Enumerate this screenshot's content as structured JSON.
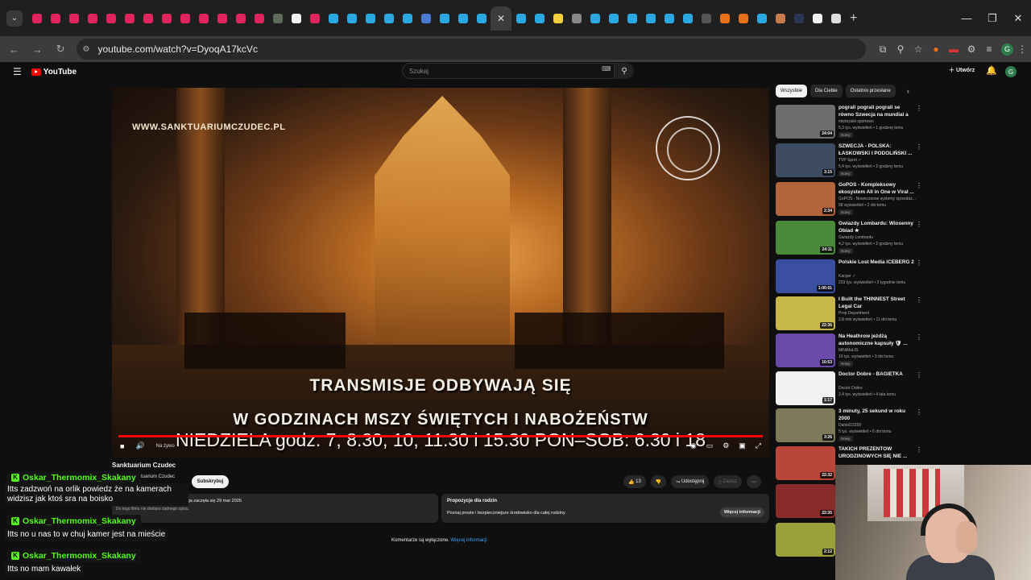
{
  "browser": {
    "url": "youtube.com/watch?v=DyoqA17kcVc",
    "tab_favicons": [
      "#e0245e",
      "#e0245e",
      "#e0245e",
      "#e0245e",
      "#e0245e",
      "#e0245e",
      "#e0245e",
      "#e0245e",
      "#e0245e",
      "#e0245e",
      "#e0245e",
      "#e0245e",
      "#e0245e",
      "#5f6b5a",
      "#f1f1f1",
      "#e0245e",
      "#2aa9e0",
      "#2aa9e0",
      "#2aa9e0",
      "#2aa9e0",
      "#2aa9e0",
      "#4a7bd4",
      "#2aa9e0",
      "#2aa9e0",
      "#2aa9e0"
    ],
    "tab_favicons_after": [
      "#2aa9e0",
      "#2aa9e0",
      "#f4d03f",
      "#888888",
      "#2aa9e0",
      "#2aa9e0",
      "#2aa9e0",
      "#2aa9e0",
      "#2aa9e0",
      "#2aa9e0",
      "#555555",
      "#e8711c",
      "#e8711c",
      "#2aa9e0",
      "#c77b4b",
      "#2a3550",
      "#f1f1f1",
      "#dddddd"
    ],
    "active_tab_close": "✕",
    "new_tab": "+",
    "window_buttons": [
      "—",
      "❐",
      "✕"
    ],
    "ext_icons": [
      "⧉",
      "⚲",
      "☆",
      "●",
      "▬",
      "⚙",
      "≡"
    ],
    "profile_letter": "G"
  },
  "youtube": {
    "logo_text": "YouTube",
    "search_placeholder": "Szukaj",
    "create_label": "Utwórz",
    "notif_count": "9+",
    "avatar_letter": "G"
  },
  "video": {
    "watermark": "WWW.SANKTUARIUMCZUDEC.PL",
    "caption_line1": "TRANSMISJE ODBYWAJĄ SIĘ",
    "caption_line2": "W GODZINACH MSZY ŚWIĘTYCH I NABOŻEŃSTW",
    "caption_line3": "NIEDZIELA godz. 7, 8.30, 10, 11.30 i 15.30   PON–SOB: 6.30 i 18",
    "live_label": "Na żywo",
    "progress": 1.0
  },
  "below": {
    "channel_title": "Sanktuarium Czudec",
    "channel_sub": "tuarium Czudec",
    "subscribe_label": "Subskrybuj",
    "like_count": "13",
    "share_label": "Udostępnij",
    "save_label": "Zapisz",
    "desc_viewers": "W tej chwili ogląda 1 osoba  Transmisja zaczęła się 29 mar 2026",
    "desc_extra": "Do tego filmu nie dodano żadnego opisu.",
    "family_title": "Propozycje dla rodzin",
    "family_text": "Poznaj proste i bezpieczniejsze środowisko dla całej rodziny",
    "family_btn": "Więcej informacji",
    "comments_off": "Komentarze są wyłączone.",
    "comments_link": "Więcej informacji"
  },
  "sidebar": {
    "chips": [
      "Wszystkie",
      "Dla Ciebie",
      "Ostatnio przesłane"
    ],
    "items": [
      {
        "title": "pograli pograli pograli se równo Szwecja na mundial a Polska ...",
        "channel": "miętoyiski sportowo",
        "meta": "5,3 tys. wyświetleń • 1 godzinę temu",
        "badge": "Nowy",
        "dur": "24:04",
        "color": "#6d6d6d"
      },
      {
        "title": "SZWECJA - POLSKA: ŁASKOWSKI I PODOLIŃSKI ...",
        "channel": "TVP Sport ✓",
        "meta": "5,4 tys. wyświetleń • 2 godziny temu",
        "badge": "Nowy",
        "dur": "3:15",
        "color": "#3d4b63"
      },
      {
        "title": "GoPOS - Kompleksowy ekosystem All in One w Viral ...",
        "channel": "GoPOS - Nowoczesne systemy sprzedaż...",
        "meta": "58 wyświetleń • 2 dni temu",
        "badge": "Nowy",
        "dur": "2:34",
        "color": "#b3643b"
      },
      {
        "title": "Gwiazdy Lombardu: Wiosenny Obiad ★",
        "channel": "Gwiazdy Lombardu",
        "meta": "4,2 tys. wyświetleń • 2 godziny temu",
        "badge": "Nowy",
        "dur": "24:11",
        "color": "#4a8a3a"
      },
      {
        "title": "Polskie Lost Media ICEBERG 2",
        "channel": "Kacper ✓",
        "meta": "233 tys. wyświetleń • 2 tygodnie temu",
        "badge": "",
        "dur": "1:00:01",
        "color": "#3a4fa0"
      },
      {
        "title": "I Built the THINNEST Street Legal Car",
        "channel": "Prop Department",
        "meta": "2,8 mln wyświetleń • 11 dni temu",
        "badge": "",
        "dur": "22:36",
        "color": "#c7b64a"
      },
      {
        "title": "Na Heathrow jeżdżą autonomiczne kapsuły 🛡 ...",
        "channel": "MiNiMaLIS",
        "meta": "10 tys. wyświetleń • 3 dni temu",
        "badge": "Nowy",
        "dur": "10:53",
        "color": "#6a4aa8"
      },
      {
        "title": "Doctor Dobre - BAGIETKA",
        "channel": "Doctor Dobre",
        "meta": "2,4 tys. wyświetleń • 4 lata temu",
        "badge": "",
        "dur": "1:17",
        "color": "#f1f1f1"
      },
      {
        "title": "3 minuty, 25 sekund w roku 2000",
        "channel": "Daniel22259",
        "meta": "5 tys. wyświetleń • 6 dni temu",
        "badge": "Nowy",
        "dur": "3:26",
        "color": "#7d7a5a"
      },
      {
        "title": "TAKICH PREZENTÓW URODZINOWYCH SIĘ NIE ...",
        "channel": "",
        "meta": "",
        "badge": "",
        "dur": "22:32",
        "color": "#b8473a"
      },
      {
        "title": "",
        "channel": "",
        "meta": "",
        "badge": "",
        "dur": "22:35",
        "color": "#8a2a2a"
      },
      {
        "title": "",
        "channel": "",
        "meta": "",
        "badge": "",
        "dur": "2:12",
        "color": "#9aa03a"
      }
    ]
  },
  "chat": [
    {
      "user": "Oskar_Thermomix_Skakany",
      "msg": "Itts zadzwoń na orlik powiedz że na kamerach widzisz jak ktoś sra na boisko"
    },
    {
      "user": "Oskar_Thermomix_Skakany",
      "msg": "Itts no u nas to w chuj kamer jest na mieście"
    },
    {
      "user": "Oskar_Thermomix_Skakany",
      "msg": "Itts no mam kawałek"
    }
  ]
}
